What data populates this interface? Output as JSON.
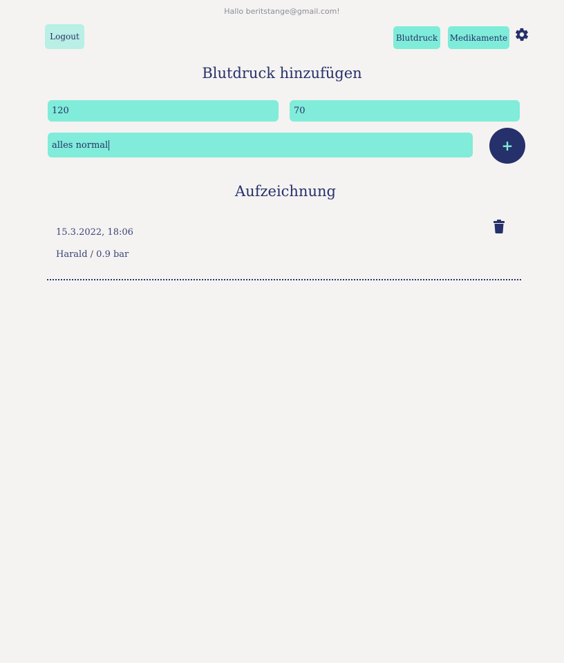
{
  "header": {
    "greeting": "Hallo beritstange@gmail.com!",
    "logout_label": "Logout",
    "nav": {
      "blutdruck_label": "Blutdruck",
      "medikamente_label": "Medikamente",
      "settings_icon": "gear-icon"
    }
  },
  "form": {
    "title": "Blutdruck hinzufügen",
    "systolic_value": "120",
    "diastolic_value": "70",
    "note_value": "alles normal",
    "add_button_label": "+"
  },
  "records": {
    "title": "Aufzeichnung",
    "items": [
      {
        "date": "15.3.2022, 18:06",
        "detail": "Harald / 0.9 bar",
        "delete_icon": "trash-icon"
      }
    ]
  },
  "colors": {
    "accent": "#80ecd9",
    "primary": "#26306b",
    "background": "#f4f3f1"
  }
}
